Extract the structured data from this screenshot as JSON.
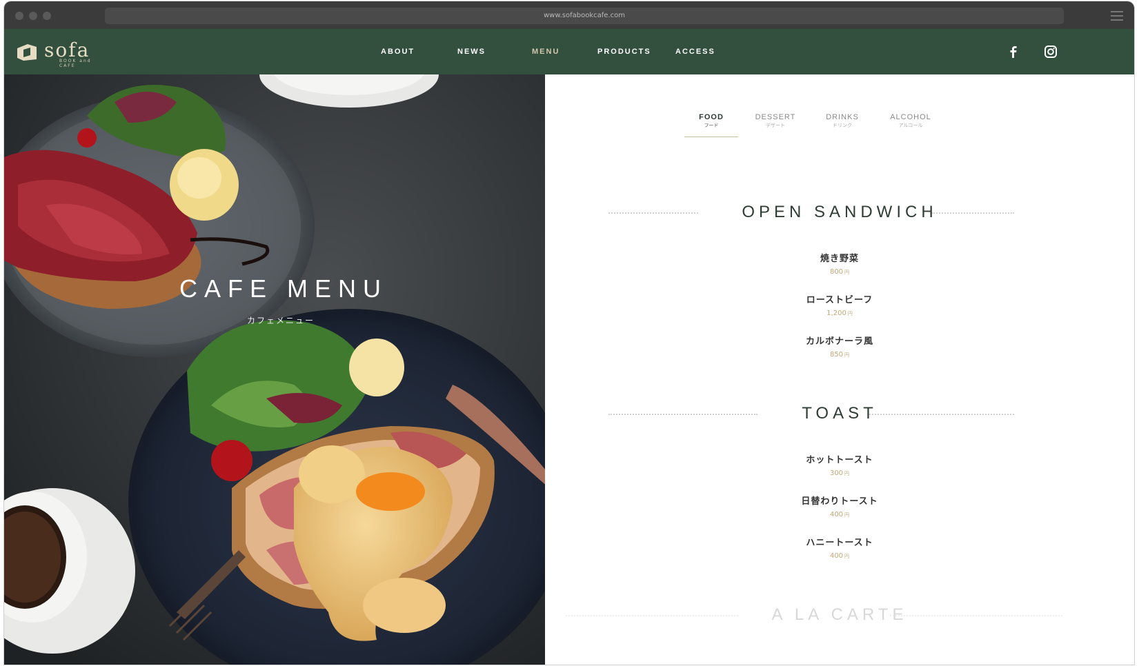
{
  "browser": {
    "url": "www.sofabookcafe.com"
  },
  "logo": {
    "word": "sofa",
    "sub": "BOOK and CAFE"
  },
  "nav": [
    {
      "label": "ABOUT"
    },
    {
      "label": "NEWS"
    },
    {
      "label": "MENU",
      "active": true
    },
    {
      "label": "PRODUCTS"
    },
    {
      "label": "ACCESS"
    }
  ],
  "social": {
    "facebook": "facebook-icon",
    "instagram": "instagram-icon"
  },
  "hero": {
    "title": "CAFE MENU",
    "subtitle": "カフェメニュー"
  },
  "tabs": [
    {
      "en": "FOOD",
      "jp": "フード",
      "active": true
    },
    {
      "en": "DESSERT",
      "jp": "デザート"
    },
    {
      "en": "DRINKS",
      "jp": "ドリンク"
    },
    {
      "en": "ALCOHOL",
      "jp": "アルコール"
    }
  ],
  "sections": [
    {
      "title": "OPEN SANDWICH",
      "items": [
        {
          "name": "焼き野菜",
          "price": "800",
          "unit": "円"
        },
        {
          "name": "ローストビーフ",
          "price": "1,200",
          "unit": "円"
        },
        {
          "name": "カルボナーラ風",
          "price": "850",
          "unit": "円"
        }
      ]
    },
    {
      "title": "TOAST",
      "items": [
        {
          "name": "ホットトースト",
          "price": "300",
          "unit": "円"
        },
        {
          "name": "日替わりトースト",
          "price": "400",
          "unit": "円"
        },
        {
          "name": "ハニートースト",
          "price": "400",
          "unit": "円"
        }
      ]
    },
    {
      "title": "A LA CARTE"
    }
  ],
  "colors": {
    "header": "#33503f",
    "accent": "#c2a878",
    "title": "#2f3d35"
  }
}
